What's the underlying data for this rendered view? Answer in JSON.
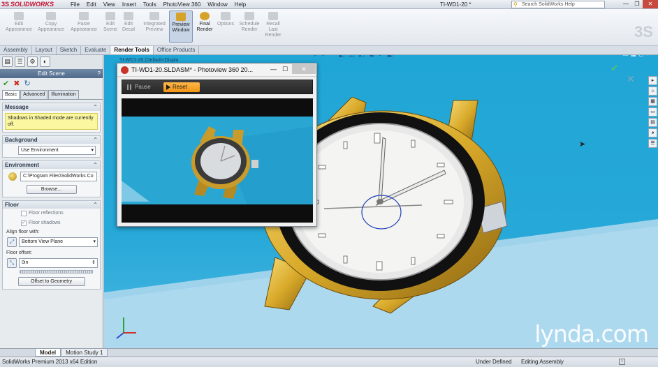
{
  "app": {
    "brand": "SOLIDWORKS",
    "document_title": "TI-WD1-20 *",
    "menu": [
      "File",
      "Edit",
      "View",
      "Insert",
      "Tools",
      "PhotoView 360",
      "Window",
      "Help"
    ],
    "search_placeholder": "Search SolidWorks Help"
  },
  "ribbon": {
    "buttons": [
      {
        "label": "Edit\nAppearance"
      },
      {
        "label": "Copy\nAppearance"
      },
      {
        "label": "Paste\nAppearance"
      },
      {
        "label": "Edit\nScene"
      },
      {
        "label": "Edit\nDecal"
      },
      {
        "label": "Integrated\nPreview"
      },
      {
        "label": "Preview\nWindow"
      },
      {
        "label": "Final\nRender"
      },
      {
        "label": "Options"
      },
      {
        "label": "Schedule\nRender"
      },
      {
        "label": "Recall\nLast\nRender"
      }
    ]
  },
  "tabs": [
    "Assembly",
    "Layout",
    "Sketch",
    "Evaluate",
    "Render Tools",
    "Office Products"
  ],
  "property_manager": {
    "title": "Edit Scene",
    "help": "?",
    "tabs": [
      "Basic",
      "Advanced",
      "Illumination"
    ],
    "message": {
      "heading": "Message",
      "text": "Shadows in Shaded mode are currently off."
    },
    "background": {
      "heading": "Background",
      "value": "Use Environment"
    },
    "environment": {
      "heading": "Environment",
      "path": "C:\\Program Files\\SolidWorks Co",
      "browse": "Browse..."
    },
    "floor": {
      "heading": "Floor",
      "reflections": "Floor reflections",
      "shadows": "Floor shadows",
      "align_label": "Align floor with:",
      "align_value": "Bottom View Plane",
      "offset_label": "Floor offset:",
      "offset_value": "0in",
      "offset_button": "Offset to Geometry"
    }
  },
  "viewport": {
    "crumb": "TI-WD1-20  (Default<Displa",
    "watermark": "lynda.com"
  },
  "photoview": {
    "title": "TI-WD1-20.SLDASM* - Photoview 360 20...",
    "pause": "Pause",
    "reset": "Reset"
  },
  "bottom_tabs": [
    "Model",
    "Motion Study 1"
  ],
  "status": {
    "edition": "SolidWorks Premium 2013 x64 Edition",
    "state": "Under Defined",
    "mode": "Editing Assembly",
    "info": "i"
  },
  "colors": {
    "accent_orange": "#f2a12a",
    "viewport_blue": "#22a7d8",
    "watch_gold": "#d9aa2a",
    "cancel_red": "#c52a1d",
    "ok_green": "#2c9b2c"
  }
}
